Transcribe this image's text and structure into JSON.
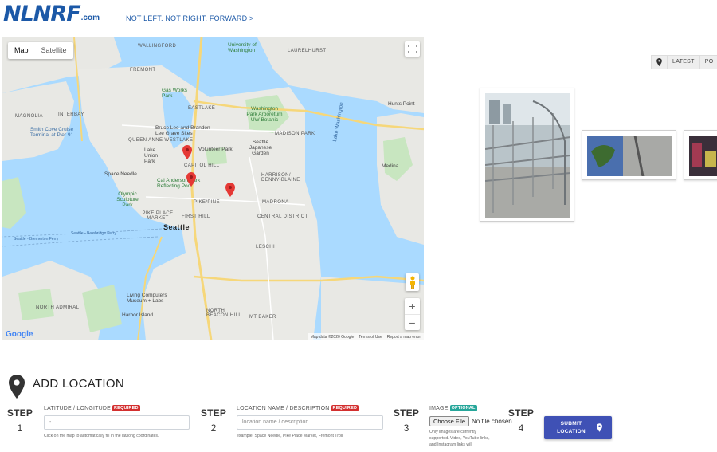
{
  "header": {
    "logo_main": "NLNRF",
    "logo_suffix": ".com",
    "tagline": "NOT LEFT. NOT RIGHT. FORWARD >"
  },
  "map": {
    "type_controls": [
      "Map",
      "Satellite"
    ],
    "active_type": "Map",
    "google_logo": "Google",
    "footer": [
      "Map data ©2020 Google",
      "Terms of Use",
      "Report a map error"
    ],
    "zoom_in": "+",
    "zoom_out": "−",
    "labels": {
      "wallingford": "WALLINGFORD",
      "uw": "University of Washington",
      "laurelhurst": "LAURELHURST",
      "fremont": "FREMONT",
      "gasworks": "Gas Works Park",
      "magnolia": "MAGNOLIA",
      "interbay": "INTERBAY",
      "eastlake": "EASTLAKE",
      "arboretum": "Washington Park Arboretum UW Botanic",
      "hunts": "Hunts Point",
      "smithcove": "Smith Cove Cruise Terminal at Pier 91",
      "bruce": "Bruce Lee and Brandon Lee Grave Sites",
      "qa": "QUEEN ANNE WESTLAKE",
      "madison": "MADISON PARK",
      "lakeunion": "Lake Union Park",
      "volunteer": "Volunteer Park",
      "capitol": "CAPITOL HILL",
      "japanese": "Seattle Japanese Garden",
      "medina": "Medina",
      "needle": "Space Needle",
      "cal": "Cal Anderson Park Reflecting Pool",
      "harrison": "HARRISON/ DENNY-BLAINE",
      "olympic": "Olympic Sculpture Park",
      "pike": "PIKE/PINE",
      "madrona": "MADRONA",
      "pikeplace": "PIKE PLACE MARKET",
      "firsthill": "FIRST HILL",
      "central": "CENTRAL DISTRICT",
      "seattle": "Seattle",
      "ferry": "Seattle - Bainbridge Ferry",
      "bremerton": "Seattle - Bremerton Ferry",
      "leschi": "LESCHI",
      "northadmiral": "NORTH ADMIRAL",
      "livingcomputers": "Living Computers Museum + Labs",
      "harbor": "Harbor Island",
      "northbeacon": "NORTH BEACON HILL",
      "mtbaker": "MT BAKER",
      "lakewash": "Lake Washington"
    }
  },
  "tabs": [
    "LATEST",
    "PO"
  ],
  "add_location": {
    "title": "ADD LOCATION",
    "steps": [
      {
        "word": "STEP",
        "number": "1",
        "label": "LATITUDE / LONGITUDE",
        "badge": "REQUIRED",
        "value": "-",
        "hint": "Click on the map to automatically fill in the lat/long coordinates."
      },
      {
        "word": "STEP",
        "number": "2",
        "label": "LOCATION NAME / DESCRIPTION",
        "badge": "REQUIRED",
        "placeholder": "location name / description",
        "hint": "example: Space Needle, Pike Place Market, Fremont Troll"
      },
      {
        "word": "STEP",
        "number": "3",
        "label": "IMAGE",
        "badge": "OPTIONAL",
        "file_button": "Choose File",
        "file_status": "No file chosen",
        "hint": "Only images are currently supported. Video, YouTube links, and Instagram links will"
      },
      {
        "word": "STEP",
        "number": "4",
        "submit_line1": "SUBMIT",
        "submit_line2": "LOCATION"
      }
    ]
  },
  "colors": {
    "brand": "#1b58a7",
    "submit": "#3f51b5",
    "required": "#d32f2f",
    "optional": "#26a69a",
    "water": "#aadaff",
    "marker": "#e53935"
  }
}
